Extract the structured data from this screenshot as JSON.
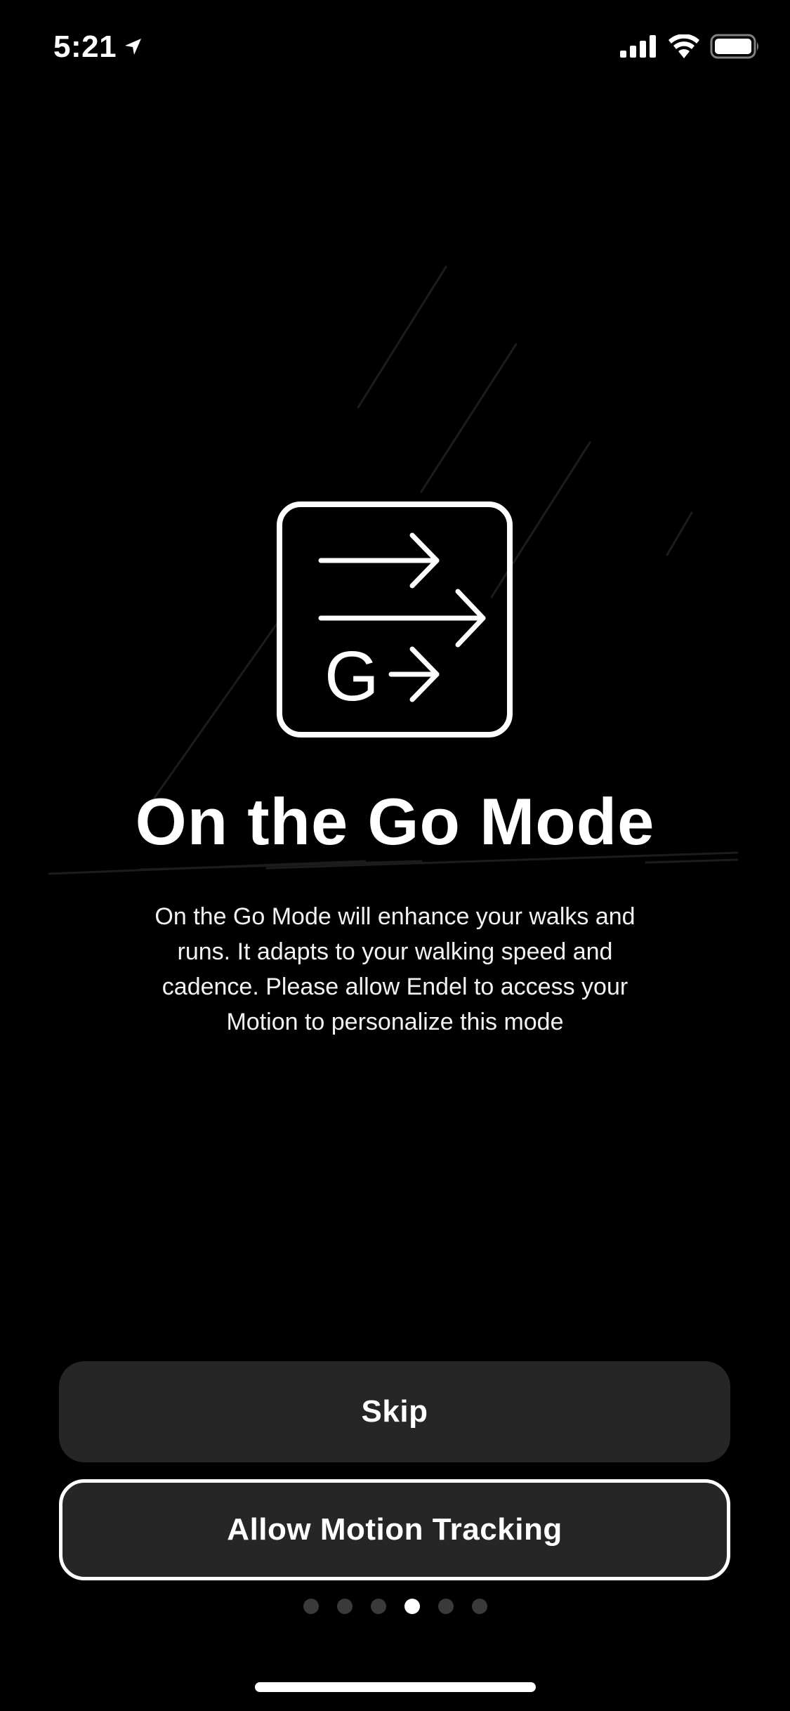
{
  "status_bar": {
    "time": "5:21",
    "icons": [
      "location-arrow-icon",
      "cellular-signal-icon",
      "wifi-icon",
      "battery-icon"
    ]
  },
  "mode": {
    "icon": "on-the-go-mode-icon",
    "icon_letter": "G",
    "title": "On the Go Mode",
    "description": "On the Go Mode will enhance your walks and runs. It adapts to your walking speed and cadence. Please allow Endel to access your Motion to personalize this mode"
  },
  "buttons": {
    "skip_label": "Skip",
    "allow_label": "Allow Motion Tracking"
  },
  "pagination": {
    "total": 6,
    "active_index": 3
  },
  "colors": {
    "background": "#000000",
    "button_fill": "#262626",
    "text": "#ffffff",
    "dot_inactive": "#3a3a3a",
    "dot_active": "#ffffff"
  }
}
